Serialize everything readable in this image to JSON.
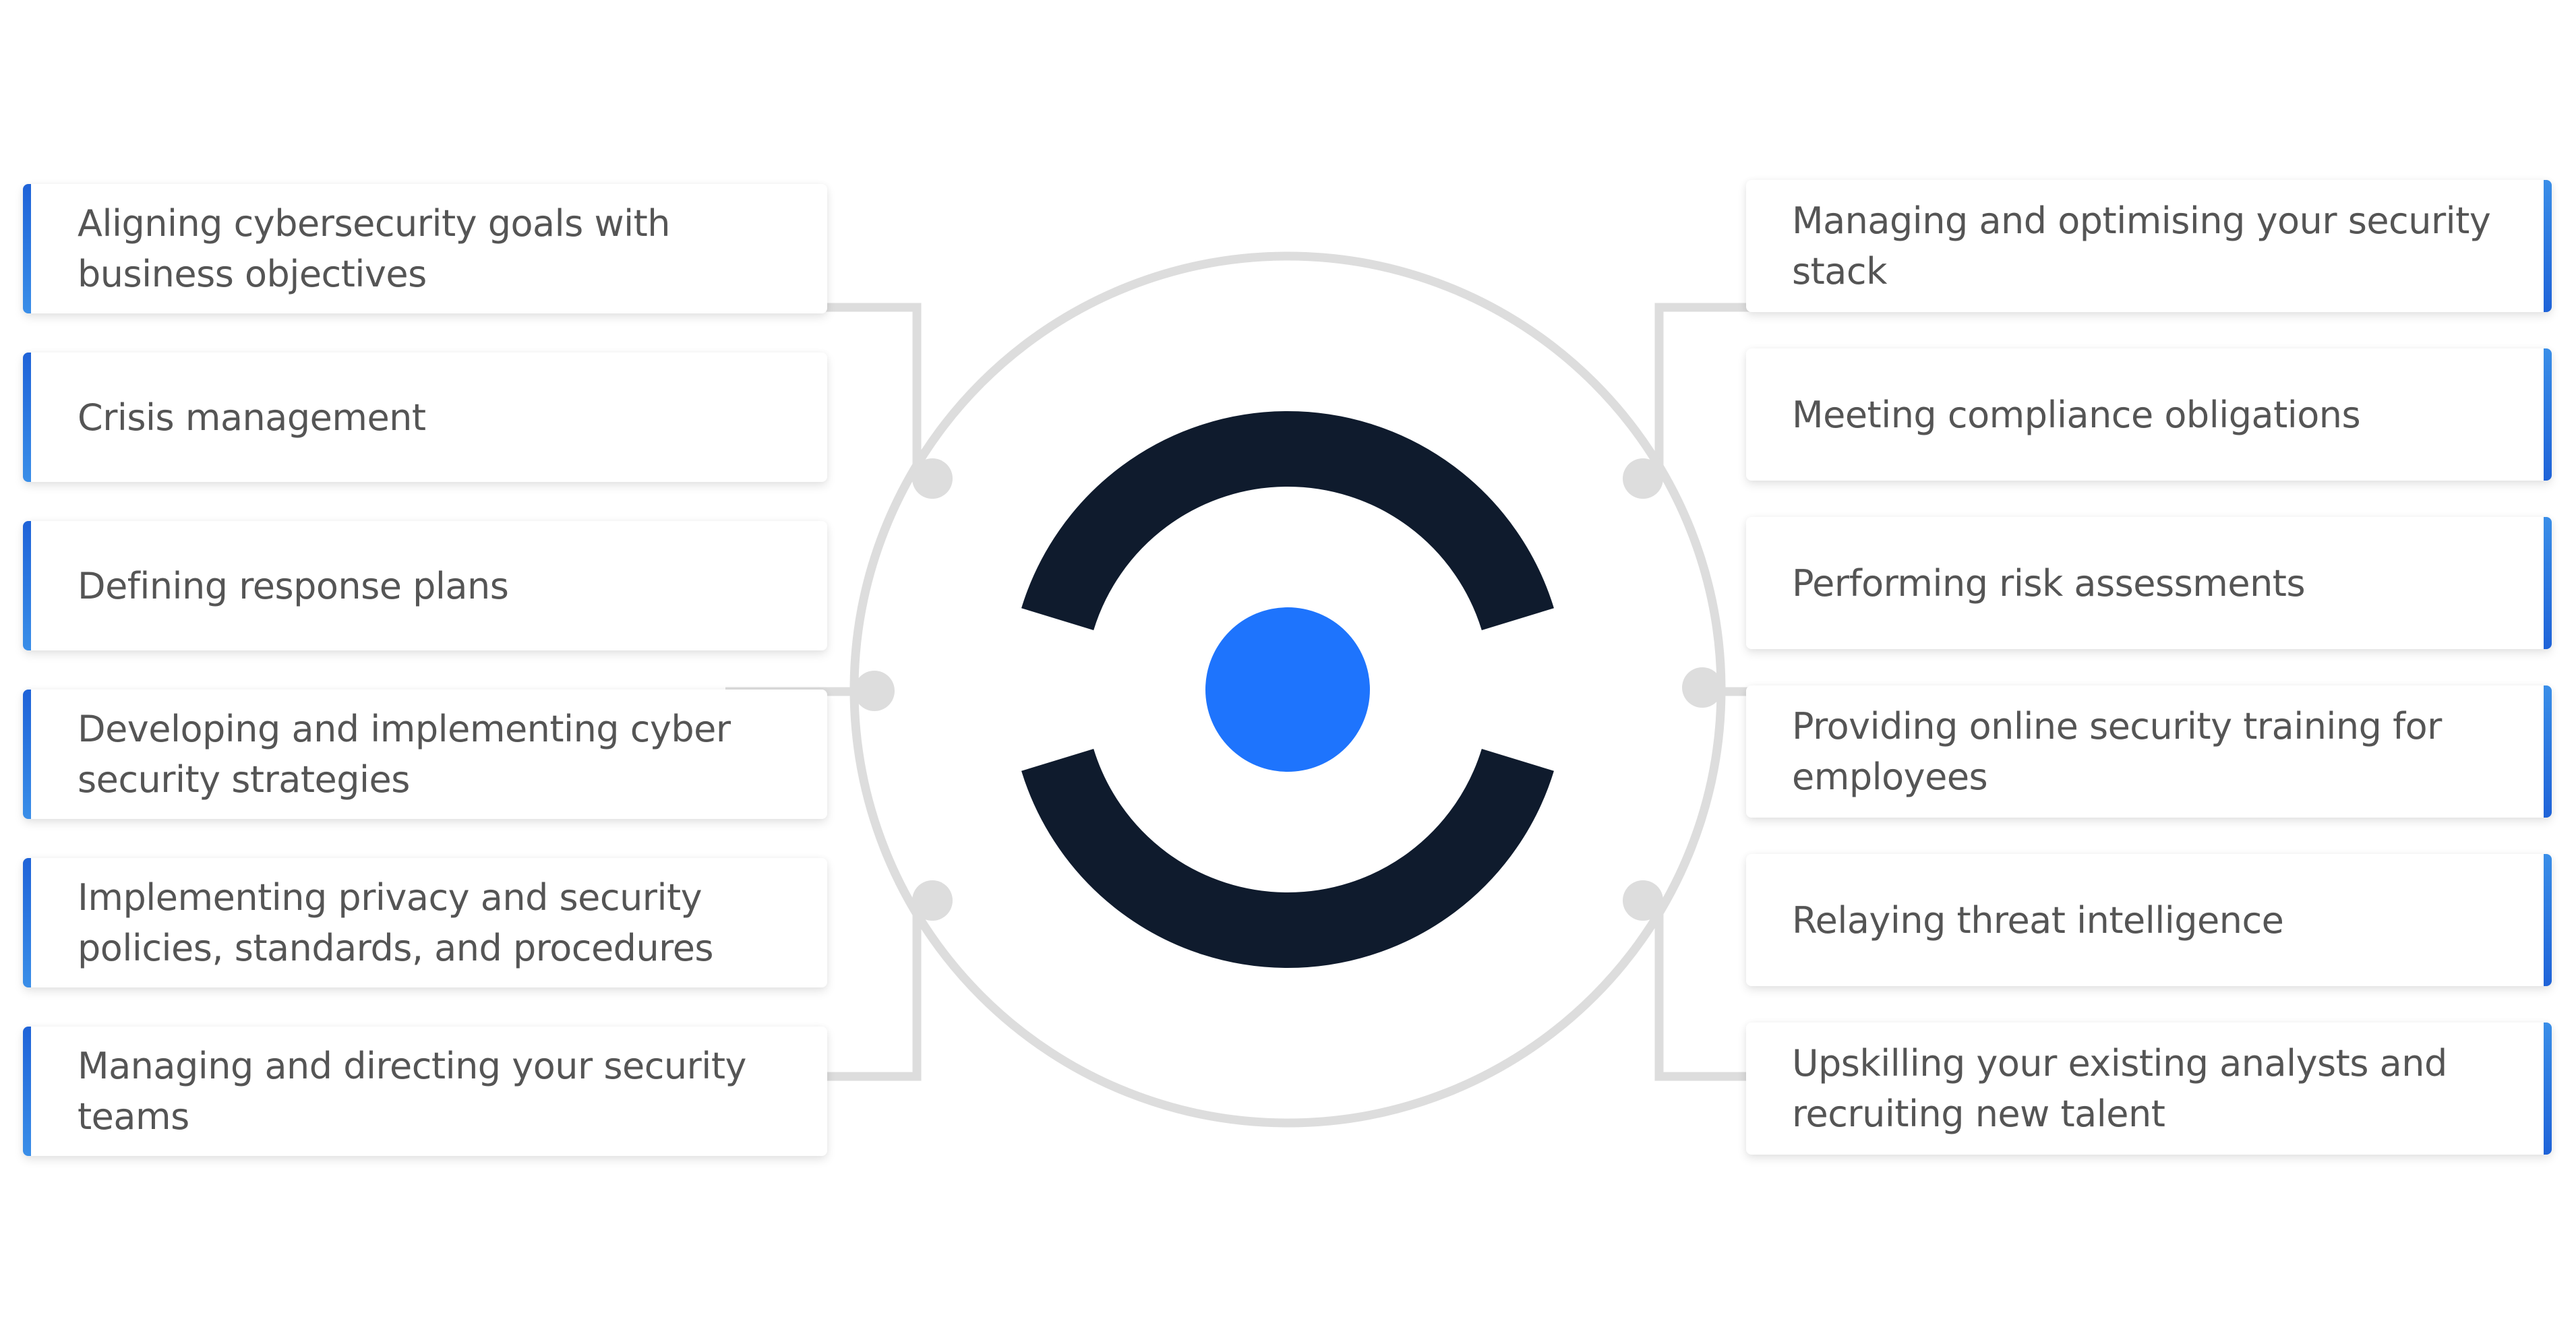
{
  "diagram": {
    "colors": {
      "accent_blue": "#1e74fd",
      "logo_dark": "#0f1b2d",
      "connector_gray": "#dddddd",
      "card_bar_light": "#3a8ee8",
      "card_bar_dark": "#1f63d8",
      "text": "#555555"
    },
    "center_icon": "eye-logo-icon",
    "left_items": [
      {
        "label": "Aligning cybersecurity goals with business objectives"
      },
      {
        "label": "Crisis management"
      },
      {
        "label": "Defining response plans"
      },
      {
        "label": "Developing and implementing cyber security strategies"
      },
      {
        "label": "Implementing privacy and security policies, standards, and procedures"
      },
      {
        "label": "Managing and directing your security teams"
      }
    ],
    "right_items": [
      {
        "label": "Managing and optimising your security stack"
      },
      {
        "label": "Meeting compliance obligations"
      },
      {
        "label": "Performing risk assessments"
      },
      {
        "label": "Providing online security training for employees"
      },
      {
        "label": "Relaying threat intelligence"
      },
      {
        "label": "Upskilling your existing analysts and recruiting new talent"
      }
    ]
  }
}
